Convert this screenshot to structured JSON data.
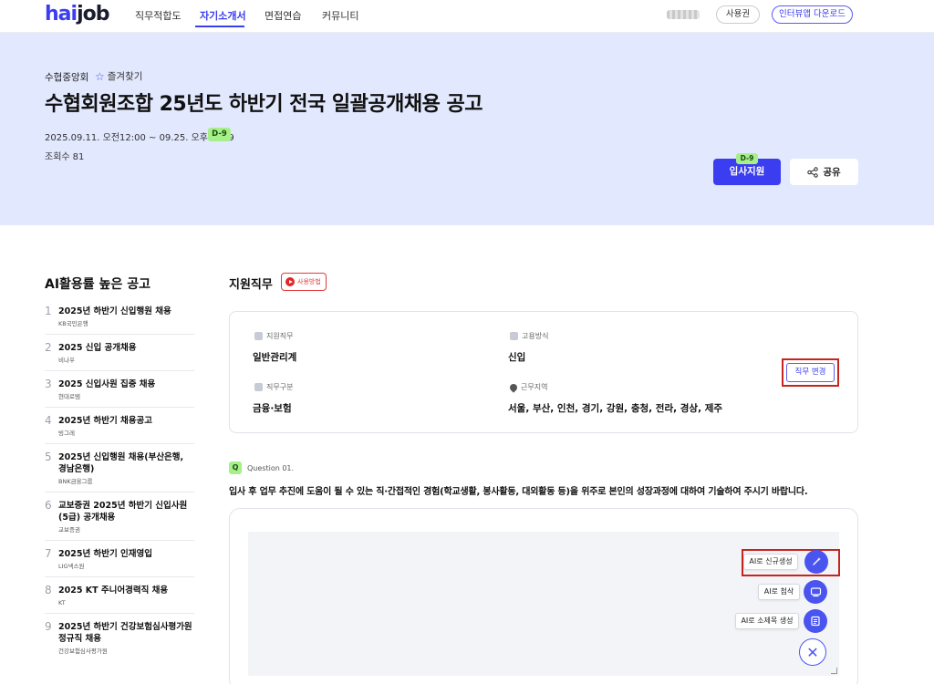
{
  "header": {
    "logo_part1": "hai",
    "logo_part2": "job",
    "nav": [
      {
        "label": "직무적합도"
      },
      {
        "label": "자기소개서"
      },
      {
        "label": "면접연습"
      },
      {
        "label": "커뮤니티"
      }
    ],
    "active_nav": "자기소개서",
    "usage_label": "사용권",
    "download_label": "인터뷰앱 다운로드"
  },
  "hero": {
    "company": "수협중앙회",
    "favorite_label": "즐겨찾기",
    "title": "수협회원조합 25년도 하반기 전국 일괄공개채용 공고",
    "period": "2025.09.11. 오전12:00 ~ 09.25. 오후11:59",
    "d_day": "D-9",
    "views_label": "조회수",
    "views_count": "81",
    "apply_label": "입사지원",
    "share_label": "공유"
  },
  "sidebar": {
    "title": "AI활용률 높은 공고",
    "items": [
      {
        "num": "1",
        "name": "2025년 하반기 신입행원 채용",
        "org": "KB국민은행"
      },
      {
        "num": "2",
        "name": "2025 신입 공개채용",
        "org": "비나우"
      },
      {
        "num": "3",
        "name": "2025 신입사원 집중 채용",
        "org": "현대로템"
      },
      {
        "num": "4",
        "name": "2025년 하반기 채용공고",
        "org": "빙그레"
      },
      {
        "num": "5",
        "name": "2025년 신입행원 채용(부산은행, 경남은행)",
        "org": "BNK금융그룹"
      },
      {
        "num": "6",
        "name": "교보증권 2025년 하반기 신입사원(5급) 공개채용",
        "org": "교보증권"
      },
      {
        "num": "7",
        "name": "2025년 하반기 인재영입",
        "org": "LIG넥스원"
      },
      {
        "num": "8",
        "name": "2025 KT 주니어경력직 채용",
        "org": "KT"
      },
      {
        "num": "9",
        "name": "2025년 하반기 건강보험심사평가원 정규직 채용",
        "org": "건강보험심사평가원"
      }
    ]
  },
  "main": {
    "section_title": "지원직무",
    "howto_label": "사용방법",
    "fields": {
      "job_label": "지원직무",
      "job_value": "일반관리계",
      "employment_label": "고용방식",
      "employment_value": "신입",
      "category_label": "직무구분",
      "category_value": "금융·보험",
      "location_label": "근무지역",
      "location_value": "서울, 부산, 인천, 경기, 강원, 충청, 전라, 경상, 제주"
    },
    "change_job_label": "직무 변경",
    "question_icon": "Q",
    "question_number": "Question 01.",
    "question_text": "입사 후 업무 추진에 도움이 될 수 있는 직·간접적인 경험(학교생활, 봉사활동, 대외활동 등)을 위주로 본인의 성장과정에 대하여 기술하여 주시기 바랍니다.",
    "ai_actions": {
      "generate": "AI로 신규생성",
      "review": "AI로 첨삭",
      "subtitle": "AI로 소제목 생성"
    }
  },
  "colors": {
    "brand": "#3b3df0",
    "hero_bg": "#e2e8fd",
    "badge_green": "#a6f08a",
    "highlight_red": "#c8241e"
  }
}
